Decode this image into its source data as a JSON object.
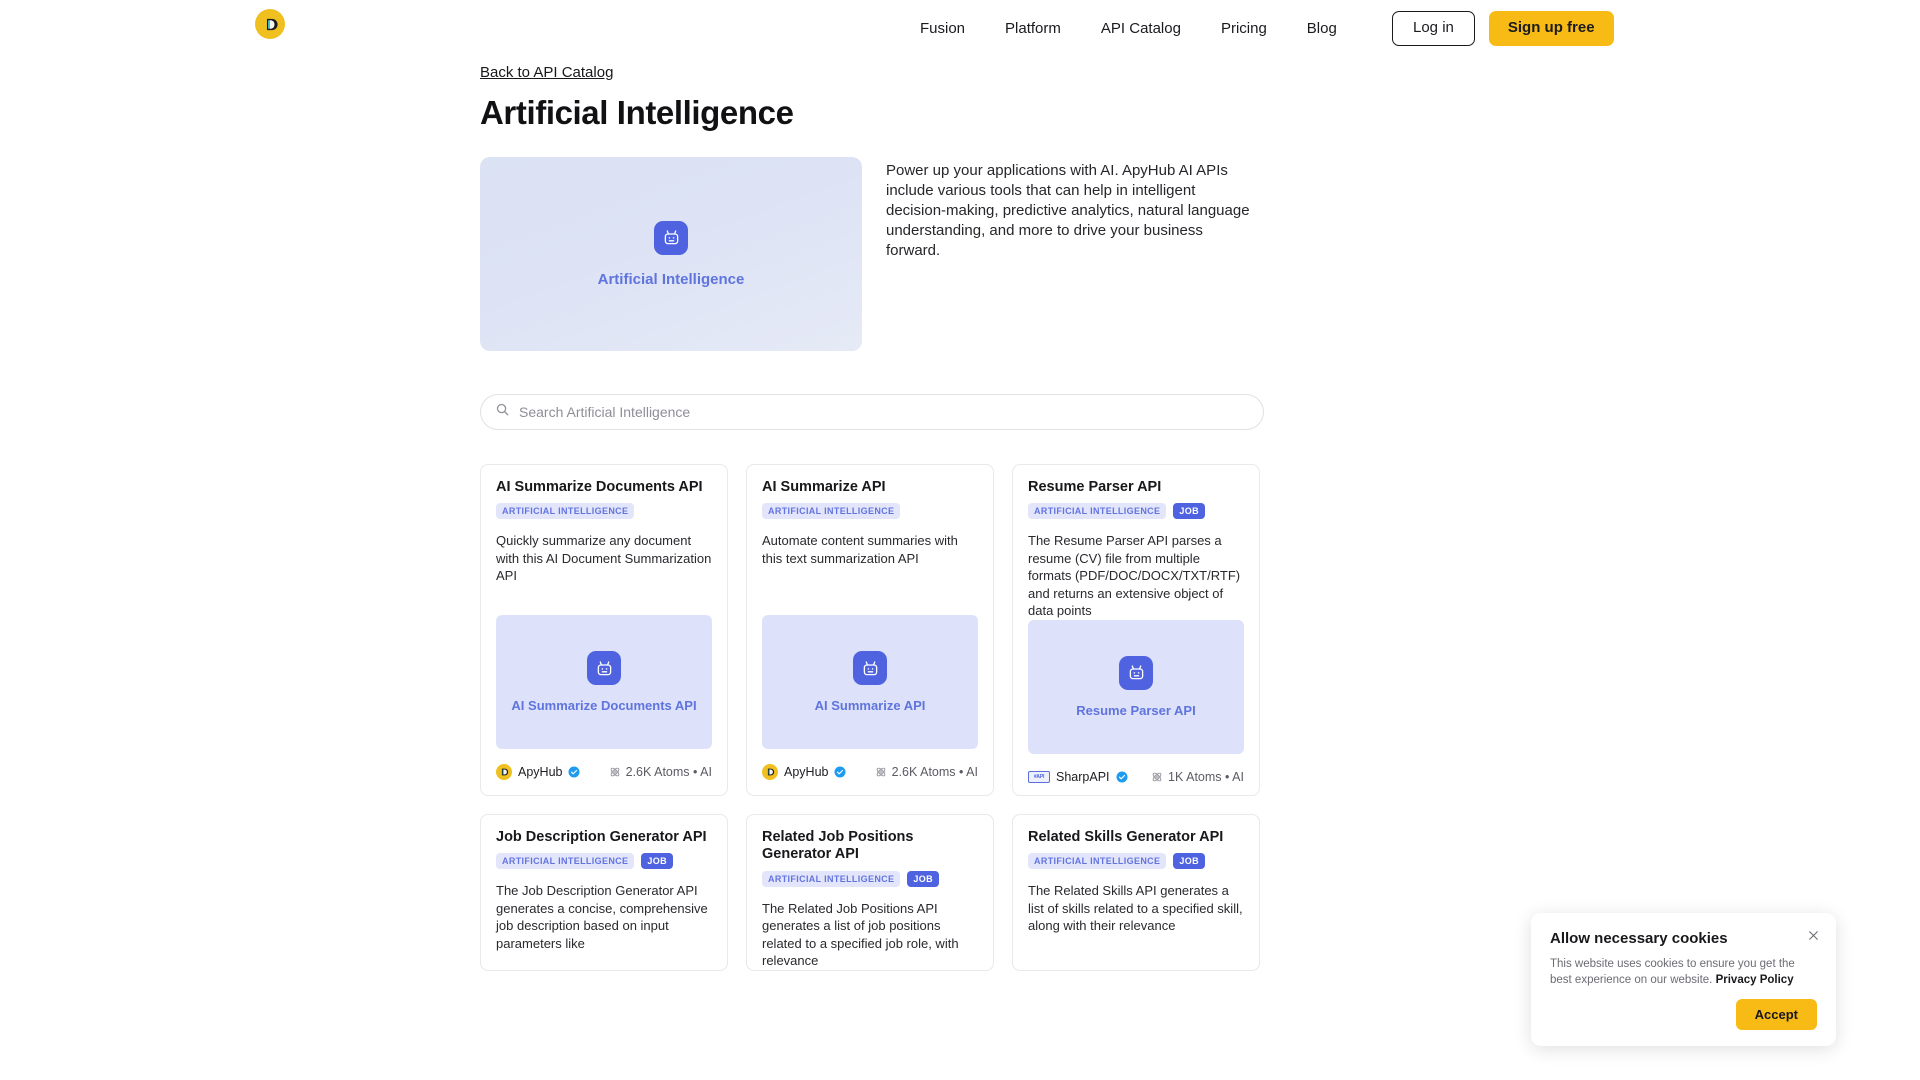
{
  "header": {
    "logo_icon": "apyhub-logo-icon",
    "nav": [
      {
        "label": "Fusion"
      },
      {
        "label": "Platform"
      },
      {
        "label": "API Catalog"
      },
      {
        "label": "Pricing"
      },
      {
        "label": "Blog"
      }
    ],
    "login_label": "Log in",
    "signup_label": "Sign up free"
  },
  "page": {
    "breadcrumb": "Back to API Catalog",
    "title": "Artificial Intelligence",
    "hero_card_label": "Artificial Intelligence",
    "hero_icon": "robot-icon",
    "hero_description": "Power up your applications with AI. ApyHub AI APIs include various tools that can help in intelligent decision-making, predictive analytics, natural language understanding, and more to drive your business forward."
  },
  "search": {
    "icon": "search-icon",
    "placeholder": "Search Artificial Intelligence",
    "value": ""
  },
  "cards": [
    {
      "title": "AI Summarize Documents API",
      "badges": [
        "ARTIFICIAL INTELLIGENCE"
      ],
      "has_job_badge": false,
      "description": "Quickly summarize any document with this AI Document Summarization API",
      "thumb_label": "AI Summarize Documents API",
      "thumb_icon": "robot-icon",
      "provider": "ApyHub",
      "provider_logo": "apyhub-logo-icon",
      "verified": true,
      "atoms": "2.6K Atoms • AI",
      "atoms_icon": "atom-icon"
    },
    {
      "title": "AI Summarize API",
      "badges": [
        "ARTIFICIAL INTELLIGENCE"
      ],
      "has_job_badge": false,
      "description": "Automate content summaries with this text summarization API",
      "thumb_label": "AI Summarize API",
      "thumb_icon": "robot-icon",
      "provider": "ApyHub",
      "provider_logo": "apyhub-logo-icon",
      "verified": true,
      "atoms": "2.6K Atoms • AI",
      "atoms_icon": "atom-icon"
    },
    {
      "title": "Resume Parser API",
      "badges": [
        "ARTIFICIAL INTELLIGENCE",
        "JOB"
      ],
      "has_job_badge": true,
      "description": "The Resume Parser API parses a resume (CV) file from multiple formats (PDF/DOC/DOCX/TXT/RTF) and returns an extensive object of data points",
      "thumb_label": "Resume Parser API",
      "thumb_icon": "robot-icon",
      "provider": "SharpAPI",
      "provider_logo": "sharpapi-logo-icon",
      "verified": true,
      "atoms": "1K Atoms • AI",
      "atoms_icon": "atom-icon"
    },
    {
      "title": "Job Description Generator API",
      "badges": [
        "ARTIFICIAL INTELLIGENCE",
        "JOB"
      ],
      "has_job_badge": true,
      "description": "The Job Description Generator API generates a concise, comprehensive job description based on input parameters like",
      "thumb_label": "",
      "thumb_icon": "",
      "provider": "",
      "provider_logo": "",
      "verified": false,
      "atoms": "",
      "atoms_icon": ""
    },
    {
      "title": "Related Job Positions Generator API",
      "badges": [
        "ARTIFICIAL INTELLIGENCE",
        "JOB"
      ],
      "has_job_badge": true,
      "description": "The Related Job Positions API generates a list of job positions related to a specified job role, with relevance",
      "thumb_label": "",
      "thumb_icon": "",
      "provider": "",
      "provider_logo": "",
      "verified": false,
      "atoms": "",
      "atoms_icon": ""
    },
    {
      "title": "Related Skills Generator API",
      "badges": [
        "ARTIFICIAL INTELLIGENCE",
        "JOB"
      ],
      "has_job_badge": true,
      "description": "The Related Skills API generates a list of skills related to a specified skill, along with their relevance",
      "thumb_label": "",
      "thumb_icon": "",
      "provider": "",
      "provider_logo": "",
      "verified": false,
      "atoms": "",
      "atoms_icon": ""
    }
  ],
  "cookie_banner": {
    "title": "Allow necessary cookies",
    "body_prefix": "This website uses cookies to ensure you get the best experience on our website.",
    "policy_link": "Privacy Policy",
    "accept_label": "Accept",
    "close_icon": "close-icon"
  },
  "colors": {
    "brand_yellow": "#F8BB16",
    "accent_blue": "#4F63E0",
    "badge_bg": "#e3e6fb",
    "thumb_bg": "#dde2fa",
    "verified_blue": "#1d9bf0"
  }
}
